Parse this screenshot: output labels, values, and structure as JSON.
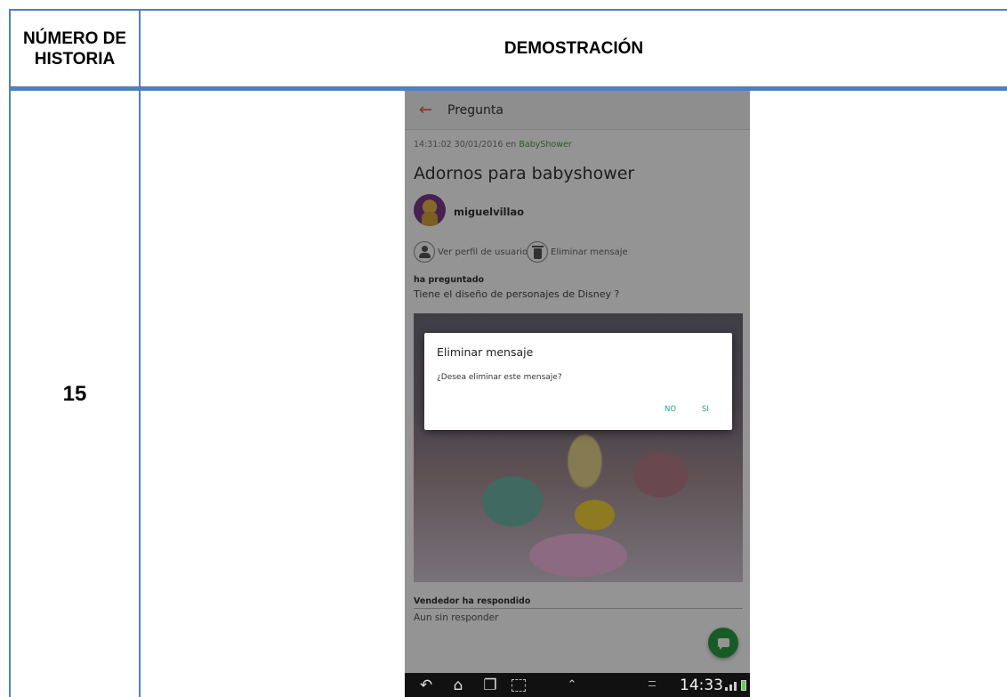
{
  "table": {
    "header_number": "NÚMERO DE HISTORIA",
    "header_demo": "DEMOSTRACIÓN",
    "row_number": "15"
  },
  "phone": {
    "appbar": {
      "back_icon": "arrow-left-icon",
      "title": "Pregunta"
    },
    "meta_time": "14:31:02 30/01/2016 en ",
    "meta_category": "BabyShower",
    "question_title": "Adornos para babyshower",
    "username": "miguelvillao",
    "actions": {
      "view_profile": "Ver perfil de usuario",
      "delete_message": "Eliminar mensaje"
    },
    "asked_label": "ha preguntado",
    "question_text": "Tiene el diseño de personajes de Disney ?",
    "reply_label": "Vendedor ha respondido",
    "reply_text": "Aun sin responder",
    "dialog": {
      "title": "Eliminar mensaje",
      "message": "¿Desea eliminar este mensaje?",
      "no_label": "NO",
      "yes_label": "SI"
    },
    "statusbar": {
      "clock": "14:33"
    }
  },
  "colors": {
    "table_border": "#4f81bd",
    "accent_orange": "#e2552b",
    "category_green": "#4a9a3c",
    "fab_green": "#2a9d3f",
    "dialog_button": "#2a9d8f"
  }
}
